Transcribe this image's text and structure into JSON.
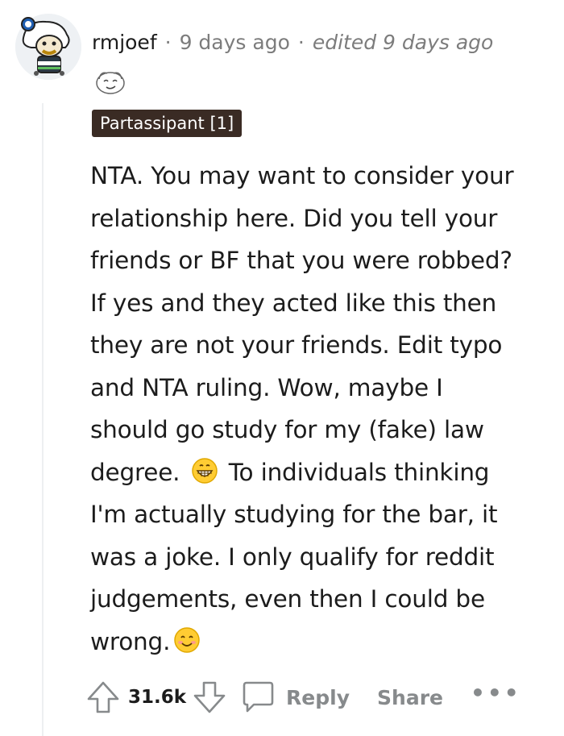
{
  "comment": {
    "username": "rmjoef",
    "separator": "·",
    "time_ago": "9 days ago",
    "edited": "edited 9 days ago",
    "flair": "Partassipant [1]",
    "avatar_icon": "snoo-avatar-icon",
    "award_icon": "award-icon",
    "body_lines": [
      "NTA. You may want to consider your",
      "relationship here. Did you tell your",
      "friends or BF that you were robbed?",
      "If yes and they acted like this then",
      "they are not your friends. Edit typo",
      "and NTA ruling. Wow, maybe I",
      "should go study for my (fake) law",
      "degree.",
      "To individuals thinking",
      "I'm actually studying for the bar, it",
      "was a joke. I only qualify for reddit",
      "judgements, even then I could be",
      "wrong."
    ]
  },
  "actions": {
    "score": "31.6k",
    "reply_label": "Reply",
    "share_label": "Share",
    "more_label": "•••"
  }
}
